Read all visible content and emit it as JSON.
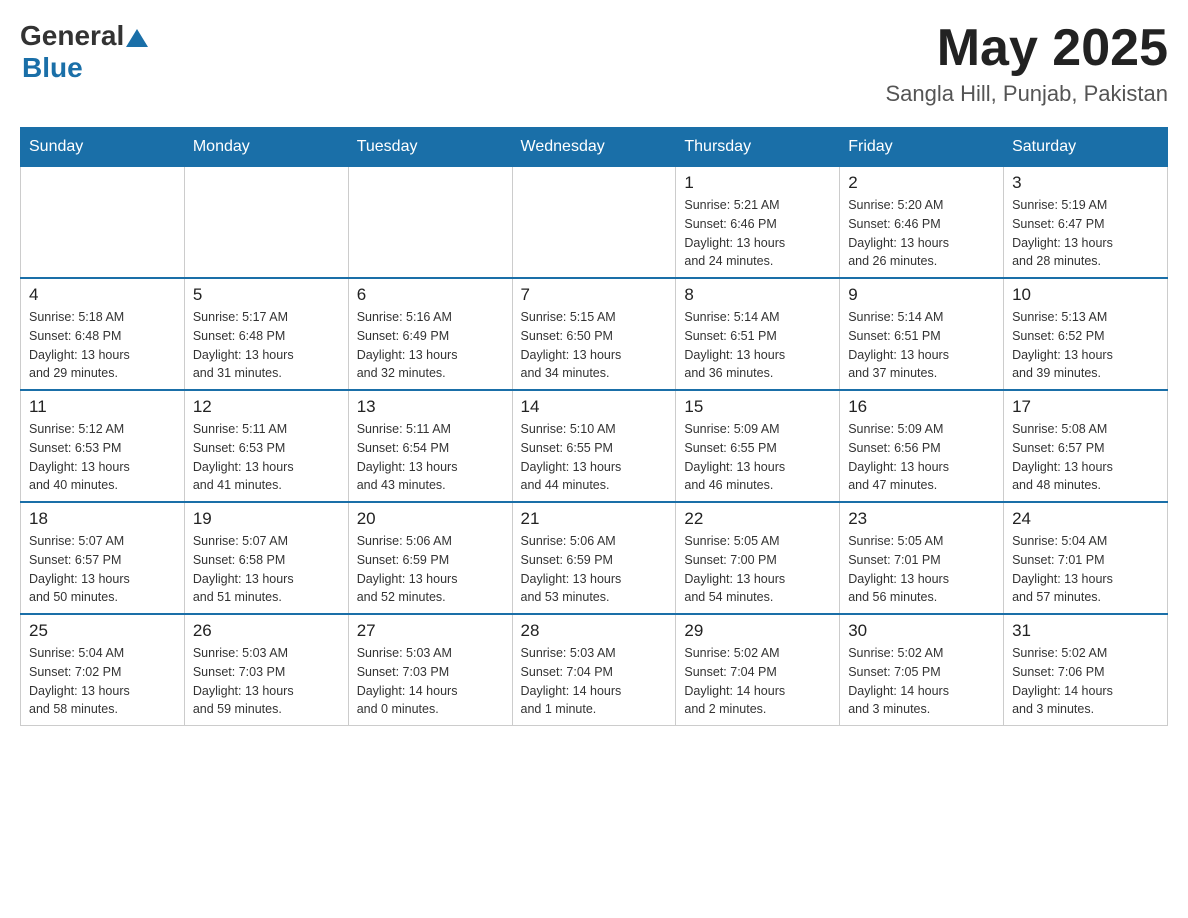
{
  "header": {
    "logo_general": "General",
    "logo_blue": "Blue",
    "month_title": "May 2025",
    "location": "Sangla Hill, Punjab, Pakistan"
  },
  "weekdays": [
    "Sunday",
    "Monday",
    "Tuesday",
    "Wednesday",
    "Thursday",
    "Friday",
    "Saturday"
  ],
  "weeks": [
    [
      {
        "day": "",
        "info": ""
      },
      {
        "day": "",
        "info": ""
      },
      {
        "day": "",
        "info": ""
      },
      {
        "day": "",
        "info": ""
      },
      {
        "day": "1",
        "info": "Sunrise: 5:21 AM\nSunset: 6:46 PM\nDaylight: 13 hours\nand 24 minutes."
      },
      {
        "day": "2",
        "info": "Sunrise: 5:20 AM\nSunset: 6:46 PM\nDaylight: 13 hours\nand 26 minutes."
      },
      {
        "day": "3",
        "info": "Sunrise: 5:19 AM\nSunset: 6:47 PM\nDaylight: 13 hours\nand 28 minutes."
      }
    ],
    [
      {
        "day": "4",
        "info": "Sunrise: 5:18 AM\nSunset: 6:48 PM\nDaylight: 13 hours\nand 29 minutes."
      },
      {
        "day": "5",
        "info": "Sunrise: 5:17 AM\nSunset: 6:48 PM\nDaylight: 13 hours\nand 31 minutes."
      },
      {
        "day": "6",
        "info": "Sunrise: 5:16 AM\nSunset: 6:49 PM\nDaylight: 13 hours\nand 32 minutes."
      },
      {
        "day": "7",
        "info": "Sunrise: 5:15 AM\nSunset: 6:50 PM\nDaylight: 13 hours\nand 34 minutes."
      },
      {
        "day": "8",
        "info": "Sunrise: 5:14 AM\nSunset: 6:51 PM\nDaylight: 13 hours\nand 36 minutes."
      },
      {
        "day": "9",
        "info": "Sunrise: 5:14 AM\nSunset: 6:51 PM\nDaylight: 13 hours\nand 37 minutes."
      },
      {
        "day": "10",
        "info": "Sunrise: 5:13 AM\nSunset: 6:52 PM\nDaylight: 13 hours\nand 39 minutes."
      }
    ],
    [
      {
        "day": "11",
        "info": "Sunrise: 5:12 AM\nSunset: 6:53 PM\nDaylight: 13 hours\nand 40 minutes."
      },
      {
        "day": "12",
        "info": "Sunrise: 5:11 AM\nSunset: 6:53 PM\nDaylight: 13 hours\nand 41 minutes."
      },
      {
        "day": "13",
        "info": "Sunrise: 5:11 AM\nSunset: 6:54 PM\nDaylight: 13 hours\nand 43 minutes."
      },
      {
        "day": "14",
        "info": "Sunrise: 5:10 AM\nSunset: 6:55 PM\nDaylight: 13 hours\nand 44 minutes."
      },
      {
        "day": "15",
        "info": "Sunrise: 5:09 AM\nSunset: 6:55 PM\nDaylight: 13 hours\nand 46 minutes."
      },
      {
        "day": "16",
        "info": "Sunrise: 5:09 AM\nSunset: 6:56 PM\nDaylight: 13 hours\nand 47 minutes."
      },
      {
        "day": "17",
        "info": "Sunrise: 5:08 AM\nSunset: 6:57 PM\nDaylight: 13 hours\nand 48 minutes."
      }
    ],
    [
      {
        "day": "18",
        "info": "Sunrise: 5:07 AM\nSunset: 6:57 PM\nDaylight: 13 hours\nand 50 minutes."
      },
      {
        "day": "19",
        "info": "Sunrise: 5:07 AM\nSunset: 6:58 PM\nDaylight: 13 hours\nand 51 minutes."
      },
      {
        "day": "20",
        "info": "Sunrise: 5:06 AM\nSunset: 6:59 PM\nDaylight: 13 hours\nand 52 minutes."
      },
      {
        "day": "21",
        "info": "Sunrise: 5:06 AM\nSunset: 6:59 PM\nDaylight: 13 hours\nand 53 minutes."
      },
      {
        "day": "22",
        "info": "Sunrise: 5:05 AM\nSunset: 7:00 PM\nDaylight: 13 hours\nand 54 minutes."
      },
      {
        "day": "23",
        "info": "Sunrise: 5:05 AM\nSunset: 7:01 PM\nDaylight: 13 hours\nand 56 minutes."
      },
      {
        "day": "24",
        "info": "Sunrise: 5:04 AM\nSunset: 7:01 PM\nDaylight: 13 hours\nand 57 minutes."
      }
    ],
    [
      {
        "day": "25",
        "info": "Sunrise: 5:04 AM\nSunset: 7:02 PM\nDaylight: 13 hours\nand 58 minutes."
      },
      {
        "day": "26",
        "info": "Sunrise: 5:03 AM\nSunset: 7:03 PM\nDaylight: 13 hours\nand 59 minutes."
      },
      {
        "day": "27",
        "info": "Sunrise: 5:03 AM\nSunset: 7:03 PM\nDaylight: 14 hours\nand 0 minutes."
      },
      {
        "day": "28",
        "info": "Sunrise: 5:03 AM\nSunset: 7:04 PM\nDaylight: 14 hours\nand 1 minute."
      },
      {
        "day": "29",
        "info": "Sunrise: 5:02 AM\nSunset: 7:04 PM\nDaylight: 14 hours\nand 2 minutes."
      },
      {
        "day": "30",
        "info": "Sunrise: 5:02 AM\nSunset: 7:05 PM\nDaylight: 14 hours\nand 3 minutes."
      },
      {
        "day": "31",
        "info": "Sunrise: 5:02 AM\nSunset: 7:06 PM\nDaylight: 14 hours\nand 3 minutes."
      }
    ]
  ]
}
